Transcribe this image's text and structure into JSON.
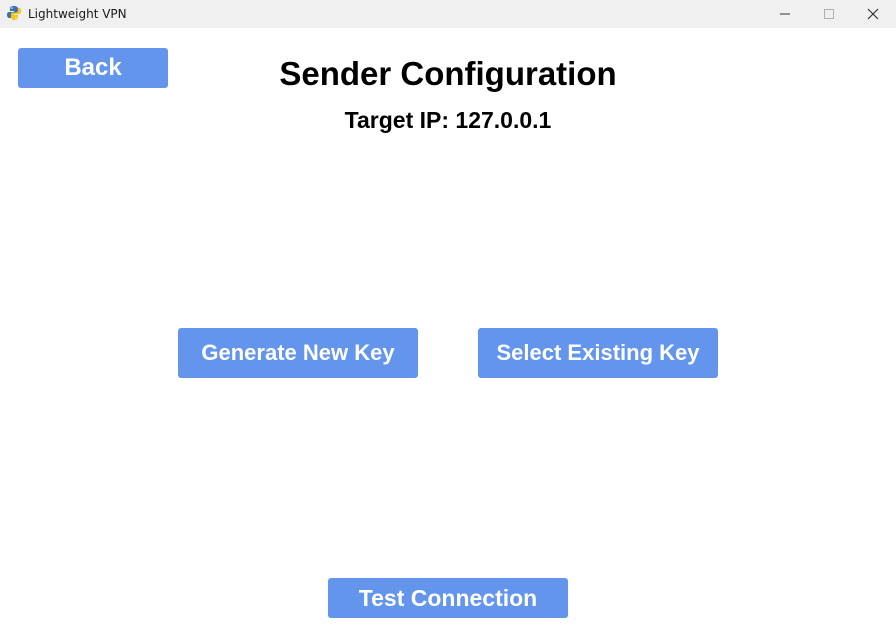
{
  "window": {
    "title": "Lightweight VPN",
    "icon": "python-snake-icon"
  },
  "header": {
    "title": "Sender Configuration",
    "target_ip": "Target IP: 127.0.0.1"
  },
  "buttons": {
    "back": "Back",
    "generate_key": "Generate New Key",
    "select_key": "Select Existing Key",
    "test_connection": "Test Connection"
  },
  "colors": {
    "button_bg": "#6495ed",
    "button_text": "#ffffff",
    "titlebar_bg": "#f0f0f0"
  }
}
